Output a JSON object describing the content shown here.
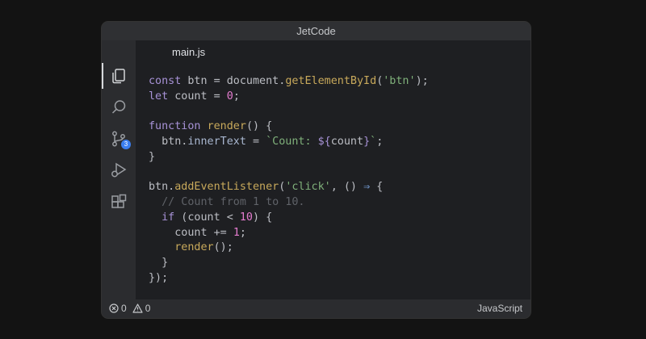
{
  "window": {
    "title": "JetCode"
  },
  "activity_bar": {
    "items": [
      {
        "icon": "files-icon",
        "active": true
      },
      {
        "icon": "search-icon"
      },
      {
        "icon": "source-control-icon",
        "badge": "3"
      },
      {
        "icon": "run-debug-icon"
      },
      {
        "icon": "extensions-icon"
      }
    ]
  },
  "editor": {
    "tab": {
      "label": "main.js"
    }
  },
  "status_bar": {
    "errors": "0",
    "warnings": "0",
    "language": "JavaScript"
  },
  "colors": {
    "keyword": "#a792d6",
    "function": "#c8a95b",
    "string": "#7fb07a",
    "number": "#e47ccf",
    "operator": "#7aa4e0",
    "comment": "#5f6268",
    "badge": "#3b7ff0"
  },
  "code": {
    "lines": [
      [
        {
          "t": "const",
          "c": "kw"
        },
        {
          "t": " btn = document."
        },
        {
          "t": "getElementById",
          "c": "fn"
        },
        {
          "t": "("
        },
        {
          "t": "'btn'",
          "c": "str"
        },
        {
          "t": ");"
        }
      ],
      [
        {
          "t": "let",
          "c": "kw"
        },
        {
          "t": " count = "
        },
        {
          "t": "0",
          "c": "num"
        },
        {
          "t": ";"
        }
      ],
      [],
      [
        {
          "t": "function",
          "c": "kw"
        },
        {
          "t": " "
        },
        {
          "t": "render",
          "c": "fn"
        },
        {
          "t": "() {"
        }
      ],
      [
        {
          "t": "  btn."
        },
        {
          "t": "innerText",
          "c": "var"
        },
        {
          "t": " = "
        },
        {
          "t": "`Count: ",
          "c": "str"
        },
        {
          "t": "${",
          "c": "kw"
        },
        {
          "t": "count"
        },
        {
          "t": "}",
          "c": "kw"
        },
        {
          "t": "`",
          "c": "str"
        },
        {
          "t": ";"
        }
      ],
      [
        {
          "t": "}"
        }
      ],
      [],
      [
        {
          "t": "btn."
        },
        {
          "t": "addEventListener",
          "c": "fn"
        },
        {
          "t": "("
        },
        {
          "t": "'click'",
          "c": "str"
        },
        {
          "t": ", () "
        },
        {
          "t": "⇒",
          "c": "op"
        },
        {
          "t": " {"
        }
      ],
      [
        {
          "t": "  // Count from 1 to 10.",
          "c": "cm"
        }
      ],
      [
        {
          "t": "  "
        },
        {
          "t": "if",
          "c": "kw"
        },
        {
          "t": " (count < "
        },
        {
          "t": "10",
          "c": "num"
        },
        {
          "t": ") {"
        }
      ],
      [
        {
          "t": "    count += "
        },
        {
          "t": "1",
          "c": "num"
        },
        {
          "t": ";"
        }
      ],
      [
        {
          "t": "    "
        },
        {
          "t": "render",
          "c": "fn"
        },
        {
          "t": "();"
        }
      ],
      [
        {
          "t": "  }"
        }
      ],
      [
        {
          "t": "});"
        }
      ]
    ]
  }
}
